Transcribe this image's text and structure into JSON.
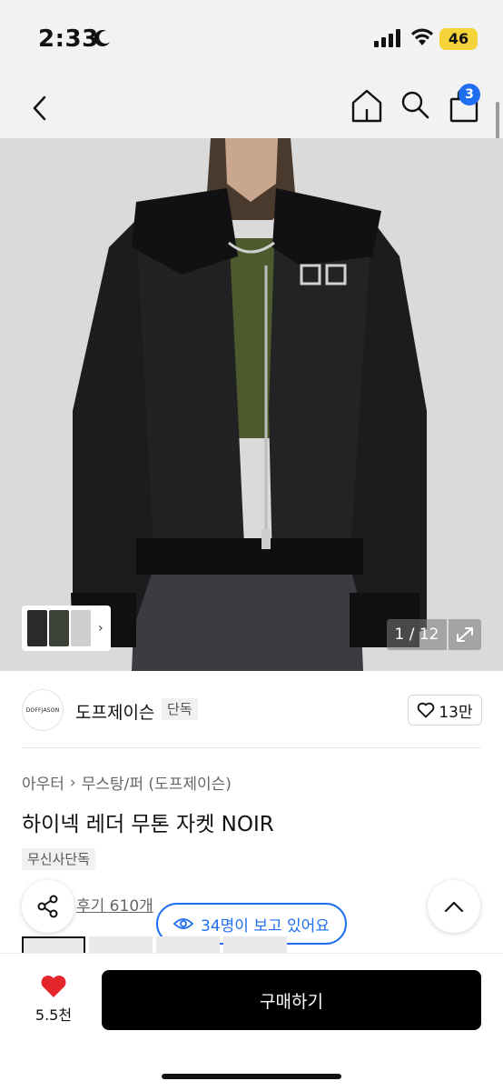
{
  "status_bar": {
    "time": "2:33",
    "battery": "46",
    "icons": [
      "moon-icon",
      "signal-icon",
      "wifi-icon",
      "battery-icon"
    ]
  },
  "nav": {
    "icons": [
      "back-icon",
      "home-icon",
      "search-icon",
      "bag-icon"
    ],
    "cart_badge": "3"
  },
  "gallery": {
    "page_current": 1,
    "page_total": 12,
    "counter_text": "1 / 12",
    "thumb_arrow": "›"
  },
  "brand": {
    "logo_text": "DOFFJASON",
    "name": "도프제이슨",
    "tag": "단독",
    "like_count": "13만"
  },
  "product": {
    "category_level1": "아우터",
    "category_separator": "›",
    "category_level2": "무스탕/퍼 (도프제이슨)",
    "title": "하이넥 레더 무톤 자켓 NOIR",
    "tag": "무신사단독",
    "review_link": "후기 610개",
    "viewers_text": "34명이 보고 있어요"
  },
  "bottom_bar": {
    "wishlist_count": "5.5천",
    "buy_label": "구매하기"
  },
  "colors": {
    "accent_blue": "#1e6ff0",
    "heart_red": "#e4252c",
    "buy_black": "#000000",
    "battery_yellow": "#f5d33a"
  }
}
